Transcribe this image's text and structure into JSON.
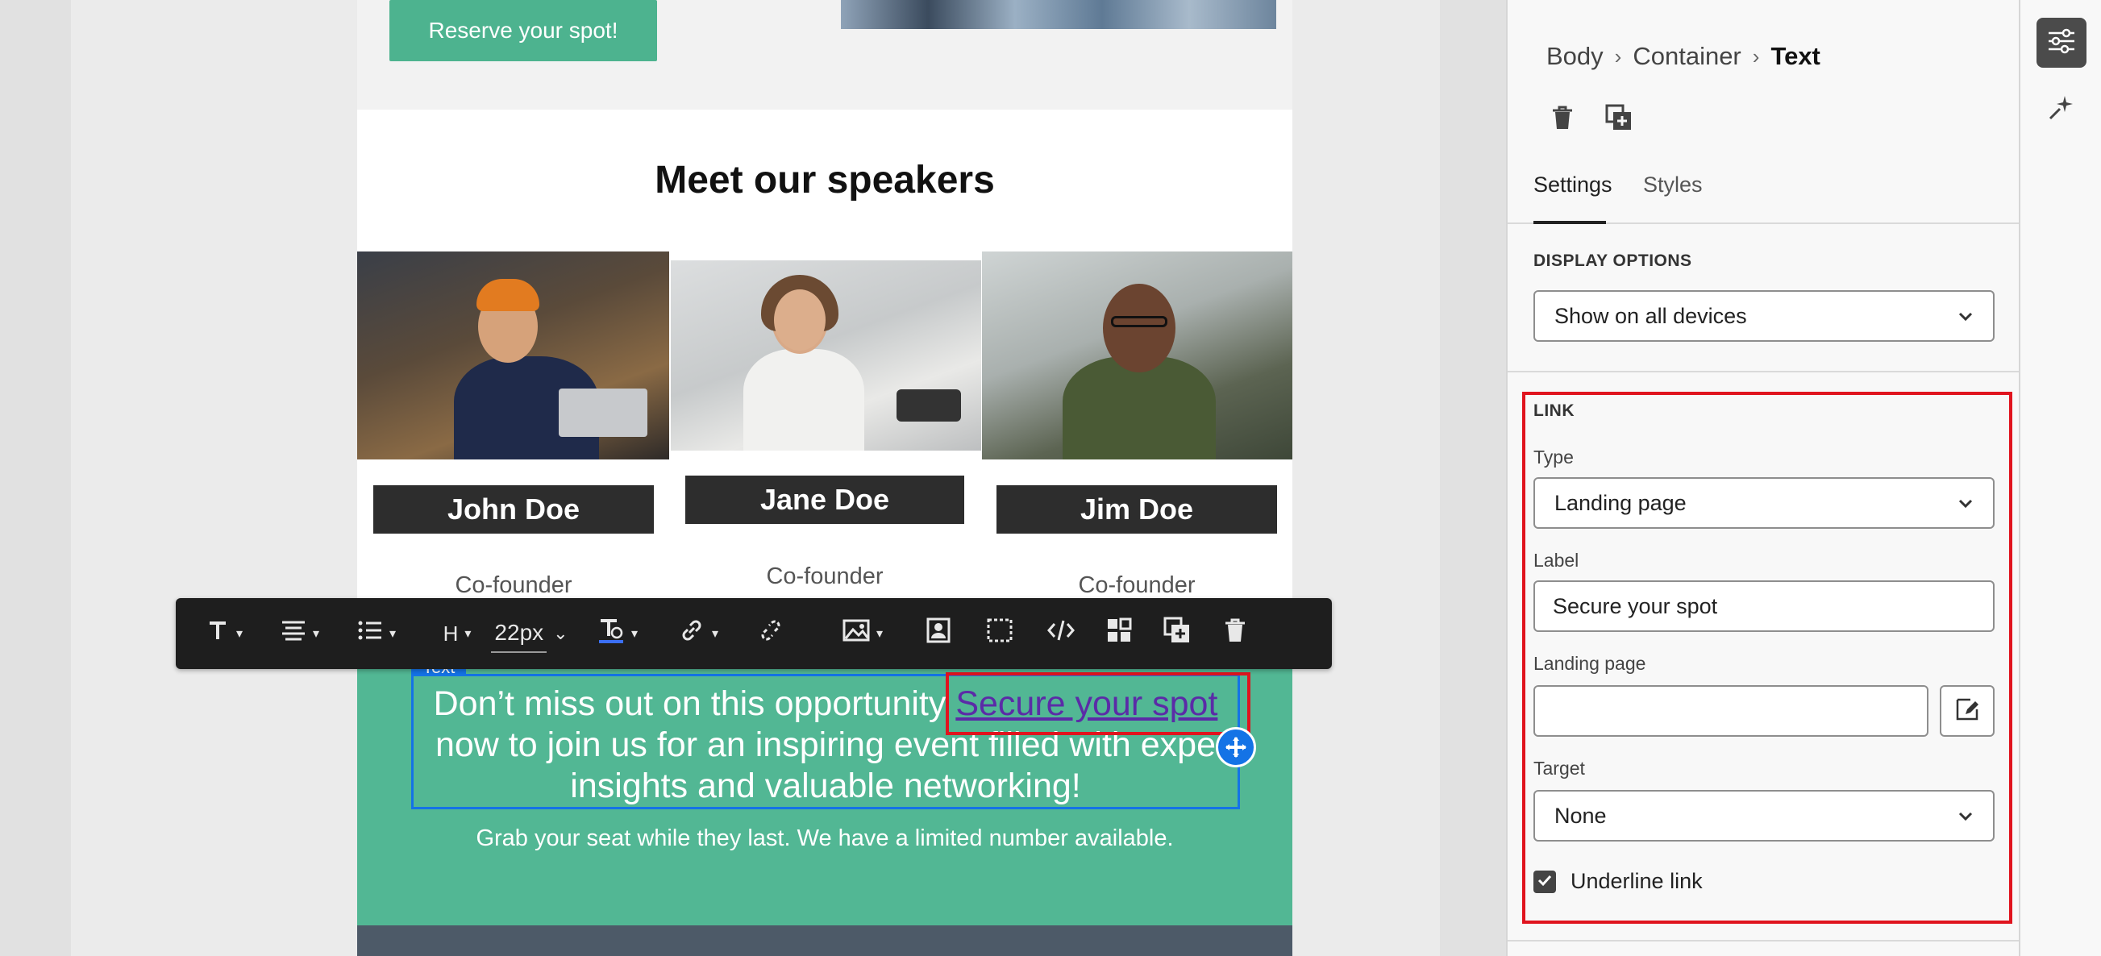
{
  "email": {
    "hero": {
      "reserve_label": "Reserve your spot!"
    },
    "speakers": {
      "title": "Meet our speakers",
      "people": [
        {
          "name": "John Doe",
          "role": "Co-founder"
        },
        {
          "name": "Jane Doe",
          "role": "Co-founder"
        },
        {
          "name": "Jim Doe",
          "role": "Co-founder"
        }
      ]
    },
    "cta": {
      "tag": "Text",
      "line1_before": "Don’t miss out on this opportunity ",
      "link_text": "Secure your spot",
      "line2": "now to join us for an inspiring event filled with expe",
      "line3": "insights and valuable networking!",
      "sub": "Grab your seat while they last. We have a limited number available."
    }
  },
  "toolbar": {
    "heading_label": "H",
    "font_size": "22px",
    "icons": [
      "text-style-icon",
      "align-icon",
      "list-icon",
      "heading-icon",
      "font-size-icon",
      "text-color-icon",
      "link-icon",
      "unlink-icon",
      "image-icon",
      "personalize-icon",
      "select-container-icon",
      "code-icon",
      "components-icon",
      "duplicate-icon",
      "delete-icon"
    ]
  },
  "panel": {
    "breadcrumb": [
      "Body",
      "Container",
      "Text"
    ],
    "tabs": [
      "Settings",
      "Styles"
    ],
    "display_options": {
      "label": "DISPLAY OPTIONS",
      "value": "Show on all devices"
    },
    "link": {
      "section_label": "LINK",
      "type_label": "Type",
      "type_value": "Landing page",
      "label_label": "Label",
      "label_value": "Secure your spot",
      "landing_label": "Landing page",
      "landing_value": "",
      "target_label": "Target",
      "target_value": "None",
      "underline_label": "Underline link",
      "underline_checked": true
    }
  },
  "colors": {
    "accent_blue": "#1473e6",
    "highlight_red": "#e0141e",
    "cta_green": "#52b794",
    "link_purple": "#5b2ba7"
  }
}
